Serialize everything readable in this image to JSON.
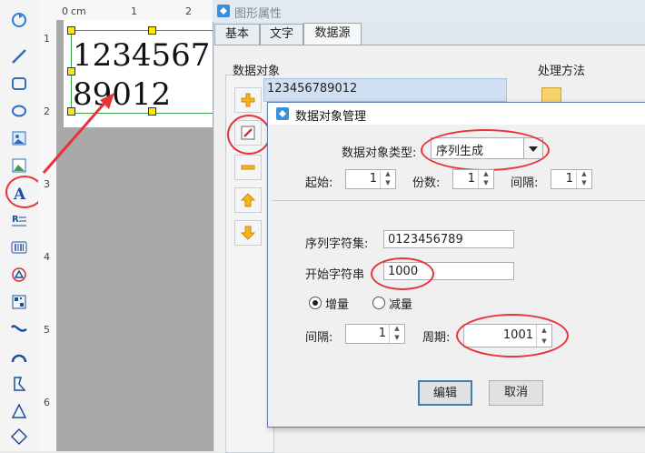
{
  "ruler": {
    "unit": "cm",
    "tick1": "1",
    "tick2": "2",
    "v1": "1",
    "v2": "2",
    "v3": "3",
    "v4": "4",
    "v5": "5",
    "v6": "6"
  },
  "label": {
    "text": "123456789012"
  },
  "window": {
    "title": "图形属性"
  },
  "tabs": [
    {
      "label": "基本"
    },
    {
      "label": "文字"
    },
    {
      "label": "数据源"
    }
  ],
  "panel": {
    "data_objects_label": "数据对象",
    "processing_label": "处理方法",
    "list_item": "123456789012"
  },
  "dialog": {
    "title": "数据对象管理",
    "type_label": "数据对象类型:",
    "type_value": "序列生成",
    "start_label": "起始:",
    "start_value": "1",
    "copies_label": "份数:",
    "copies_value": "1",
    "interval_label": "间隔:",
    "interval_value": "1",
    "charset_label": "序列字符集:",
    "charset_value": "0123456789",
    "startstr_label": "开始字符串",
    "startstr_value": "1000",
    "increase_label": "增量",
    "decrease_label": "减量",
    "interval2_label": "间隔:",
    "interval2_value": "1",
    "period_label": "周期:",
    "period_value": "1001",
    "edit_button": "编辑",
    "cancel_button": "取消"
  },
  "colors": {
    "annotation": "#e8333a",
    "accent": "#3c7fb1"
  }
}
